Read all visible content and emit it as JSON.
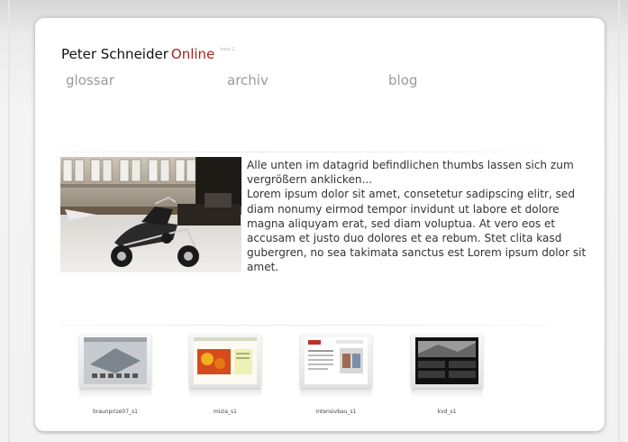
{
  "header": {
    "name": "Peter Schneider",
    "online": "Online",
    "beta": "beta 2"
  },
  "nav": {
    "items": [
      {
        "label": "glossar"
      },
      {
        "label": "archiv"
      },
      {
        "label": "blog"
      }
    ]
  },
  "intro": {
    "line1": "Alle unten im datagrid befindlichen thumbs lassen sich zum vergrößern anklicken...",
    "body": "Lorem ipsum dolor sit amet, consetetur sadipscing elitr, sed diam nonumy eirmod tempor invidunt ut labore et dolore magna aliquyam erat, sed diam voluptua. At vero eos et accusam et justo duo dolores et ea rebum. Stet clita kasd gubergren, no sea takimata sanctus est Lorem ipsum dolor sit amet."
  },
  "thumbs": [
    {
      "label": "braunprize07_s1"
    },
    {
      "label": "mizia_s1"
    },
    {
      "label": "intensivbau_s1"
    },
    {
      "label": "kvd_s1"
    }
  ],
  "colors": {
    "accent": "#a3271c",
    "nav": "#9a9a9a",
    "text": "#333333"
  }
}
